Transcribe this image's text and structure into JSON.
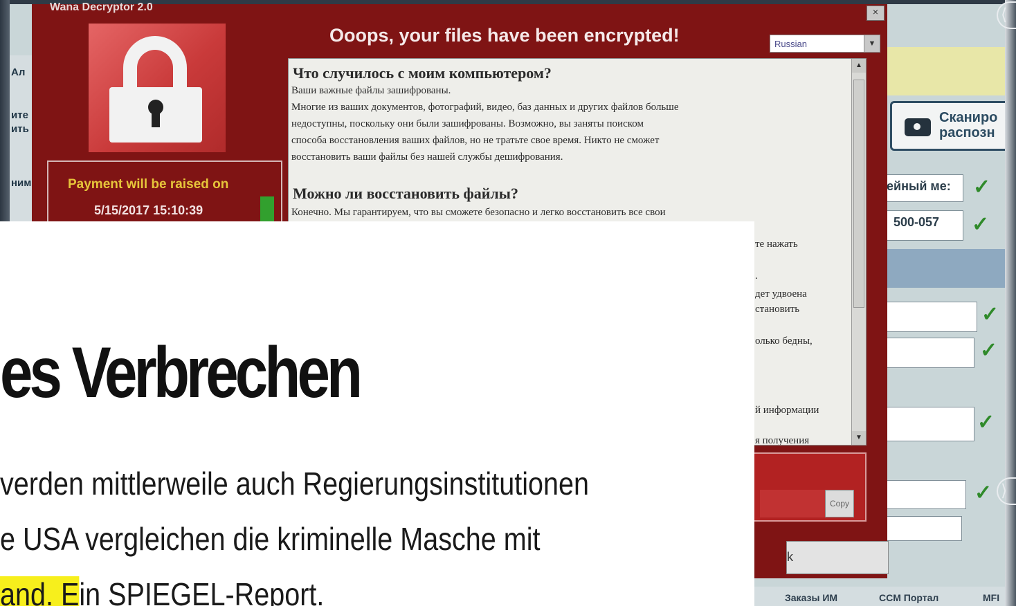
{
  "wannacry": {
    "window_title": "Wana Decryptor 2.0",
    "close_glyph": "×",
    "heading": "Ooops, your files have been encrypted!",
    "language": "Russian",
    "payment_label": "Payment will be raised on",
    "payment_date": "5/15/2017 15:10:39",
    "text": {
      "h1": "Что случилось с моим компьютером?",
      "l1": "Ваши важные файлы зашифрованы.",
      "l2": "Многие из ваших документов, фотографий, видео, баз данных и других файлов больше",
      "l3": "недоступны, поскольку они были зашифрованы. Возможно, вы заняты поиском",
      "l4": "способа восстановления ваших файлов, но не тратьте свое время. Никто не сможет",
      "l5": "восстановить ваши файлы без нашей службы дешифрования.",
      "h2": "Можно ли восстановить файлы?",
      "l6": "Конечно. Мы гарантируем, что вы сможете безопасно и легко восстановить все свои",
      "frag1": "те нажать",
      "frag2": ".",
      "frag3": "дет удвоена",
      "frag4": "становить",
      "frag5": "олько бедны,",
      "frag6": "й информации",
      "frag7": "я получения"
    },
    "copy_label": "Copy",
    "bottom_btn_label": "k"
  },
  "background_app": {
    "left_labels": [
      "Ал",
      "ите",
      "ить",
      "ним"
    ],
    "scan_button_label": "Сканиро\nраспозн",
    "fields": [
      "ейный ме:",
      "500-057"
    ],
    "check_glyph": "✓",
    "nav_links": [
      "Заказы ИМ",
      "CCM Портал",
      "MFI"
    ]
  },
  "article": {
    "title": "es Verbrechen",
    "line1": "verden mittlerweile auch Regierungsinstitutionen",
    "line2": "e USA vergleichen die kriminelle Masche mit",
    "line3_highlight": "and. E",
    "line3_rest": "in SPIEGEL-Report."
  },
  "slide_nav": {
    "next_glyph": "⟩",
    "prev_glyph": "⟨"
  }
}
